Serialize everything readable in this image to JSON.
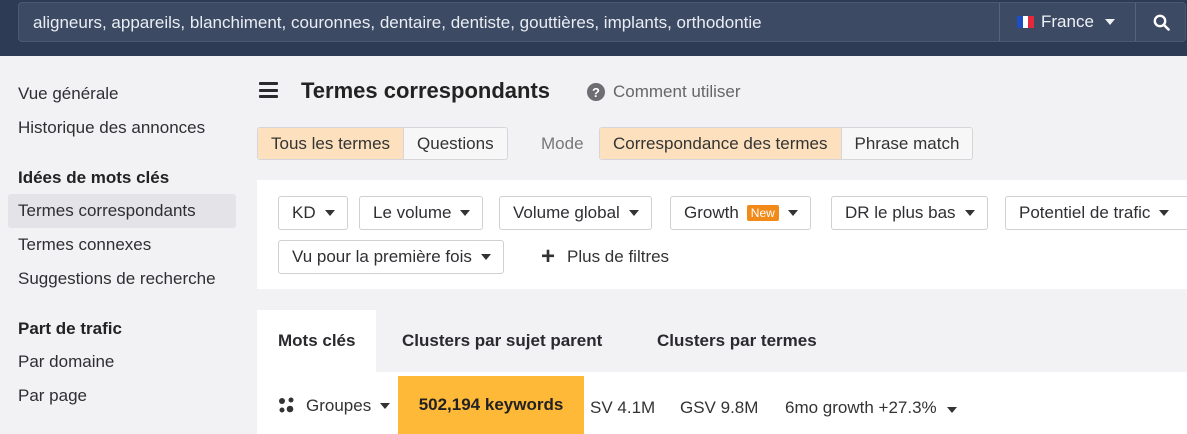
{
  "search": {
    "query": "aligneurs, appareils, blanchiment, couronnes, dentaire, dentiste, gouttières, implants, orthodontie",
    "country": "France",
    "flag_colors": [
      "#1e4fc2",
      "#ffffff",
      "#e5283b"
    ]
  },
  "sidebar": {
    "items": [
      {
        "label": "Vue générale"
      },
      {
        "label": "Historique des annonces"
      }
    ],
    "keyword_ideas_title": "Idées de mots clés",
    "keyword_ideas": [
      {
        "label": "Termes correspondants",
        "active": true
      },
      {
        "label": "Termes connexes"
      },
      {
        "label": "Suggestions de recherche"
      }
    ],
    "traffic_title": "Part de trafic",
    "traffic_items": [
      {
        "label": "Par domaine"
      },
      {
        "label": "Par page"
      }
    ]
  },
  "header": {
    "title": "Termes correspondants",
    "help_label": "Comment utiliser"
  },
  "terms_toggle": {
    "options": [
      "Tous les termes",
      "Questions"
    ],
    "selected": "Tous les termes"
  },
  "mode": {
    "label": "Mode",
    "options": [
      "Correspondance des termes",
      "Phrase match"
    ],
    "selected": "Correspondance des termes"
  },
  "filters": {
    "kd": "KD",
    "volume": "Le volume",
    "global_volume": "Volume global",
    "growth": "Growth",
    "growth_badge": "New",
    "dr_lowest": "DR le plus bas",
    "traffic_potential": "Potentiel de trafic",
    "first_seen": "Vu pour la première fois",
    "more_filters": "Plus de filtres"
  },
  "tabs": {
    "keywords": "Mots clés",
    "parent_topic": "Clusters par sujet parent",
    "terms": "Clusters par termes"
  },
  "summary": {
    "groups_label": "Groupes",
    "keywords_count": "502,194 keywords",
    "sv": "SV 4.1M",
    "gsv": "GSV 9.8M",
    "growth": "6mo growth +27.3%"
  },
  "colors": {
    "topbar": "#2e3b55",
    "selected_segment": "#fde1bf",
    "keywords_highlight": "#ffb939",
    "new_badge": "#f28a1a"
  }
}
